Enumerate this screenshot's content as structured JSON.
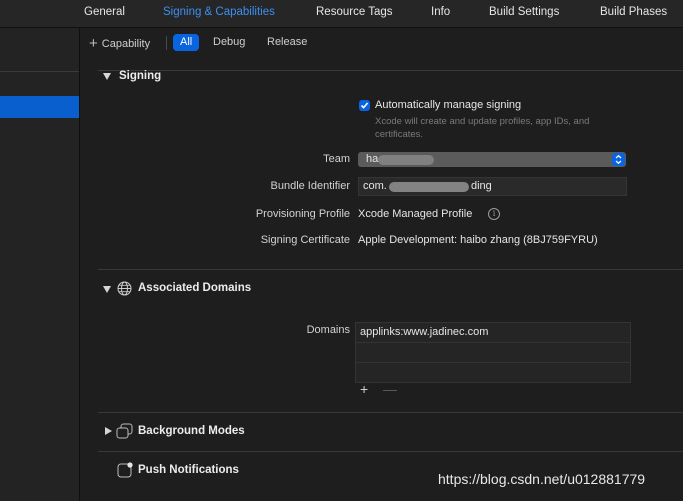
{
  "tabs": [
    {
      "label": "General"
    },
    {
      "label": "Signing & Capabilities",
      "active": true
    },
    {
      "label": "Resource Tags"
    },
    {
      "label": "Info"
    },
    {
      "label": "Build Settings"
    },
    {
      "label": "Build Phases"
    }
  ],
  "filter_bar": {
    "capability_button": "Capability",
    "segments": [
      {
        "label": "All",
        "active": true
      },
      {
        "label": "Debug"
      },
      {
        "label": "Release"
      }
    ]
  },
  "signing": {
    "title": "Signing",
    "auto_manage_label": "Automatically manage signing",
    "auto_manage_checked": true,
    "auto_manage_hint": "Xcode will create and update profiles, app IDs, and certificates.",
    "team_label": "Team",
    "team_value": "ha",
    "bundle_id_label": "Bundle Identifier",
    "bundle_id_prefix": "com.",
    "bundle_id_suffix": "ding",
    "provisioning_label": "Provisioning Profile",
    "provisioning_value": "Xcode Managed Profile",
    "certificate_label": "Signing Certificate",
    "certificate_value": "Apple Development: haibo zhang (8BJ759FYRU)"
  },
  "associated_domains": {
    "title": "Associated Domains",
    "domains_label": "Domains",
    "domains": [
      "applinks:www.jadinec.com",
      "",
      ""
    ]
  },
  "background_modes": {
    "title": "Background Modes"
  },
  "push_notifications": {
    "title": "Push Notifications"
  },
  "watermark": "https://blog.csdn.net/u012881779",
  "colors": {
    "accent": "#0a64e0",
    "active_tab": "#3d8ff0",
    "background": "#1e1e1e"
  },
  "icons": {
    "add": "plus-icon",
    "globe": "globe-icon",
    "background_modes": "background-modes-icon",
    "push": "push-notifications-icon",
    "info": "info-icon"
  }
}
